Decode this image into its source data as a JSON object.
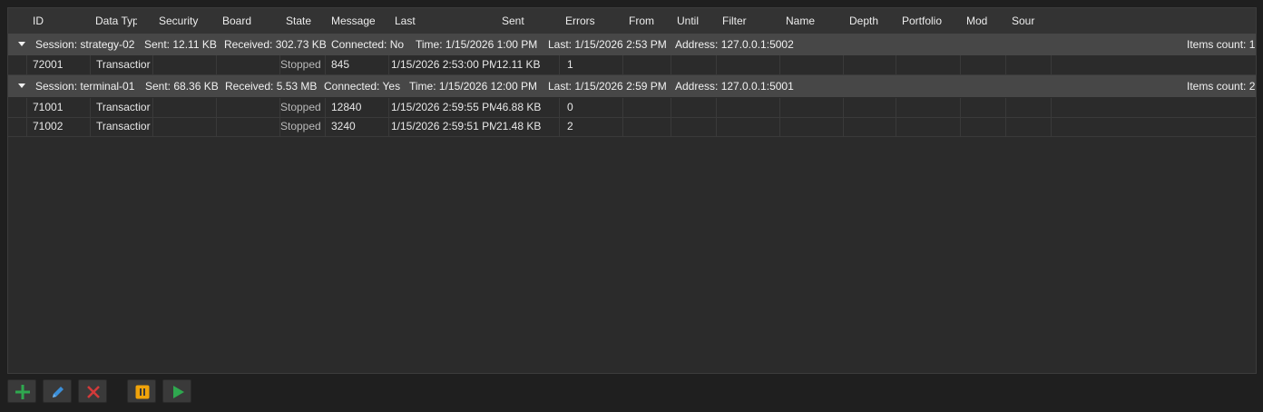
{
  "columns": [
    "ID",
    "Data Typ",
    "Security",
    "Board",
    "State",
    "Message",
    "Last",
    "Sent",
    "Errors",
    "From",
    "Until",
    "Filter",
    "Name",
    "Depth",
    "Portfolio",
    "Mod",
    "Sour"
  ],
  "groups": [
    {
      "session": "Session: strategy-02",
      "sent": "Sent: 12.11 KB",
      "received": "Received: 302.73 KB",
      "connected": "Connected: No",
      "time": "Time: 1/15/2026 1:00 PM",
      "last": "Last: 1/15/2026 2:53 PM",
      "address": "Address: 127.0.0.1:5002",
      "items_count": "Items count: 1",
      "rows": [
        {
          "id": "72001",
          "data_type": "Transactior",
          "state": "Stopped",
          "message": "845",
          "last": "1/15/2026 2:53:00 PM",
          "sent": "12.11 KB",
          "errors": "1"
        }
      ]
    },
    {
      "session": "Session: terminal-01",
      "sent": "Sent: 68.36 KB",
      "received": "Received: 5.53 MB",
      "connected": "Connected: Yes",
      "time": "Time: 1/15/2026 12:00 PM",
      "last": "Last: 1/15/2026 2:59 PM",
      "address": "Address: 127.0.0.1:5001",
      "items_count": "Items count: 2",
      "rows": [
        {
          "id": "71001",
          "data_type": "Transactior",
          "state": "Stopped",
          "message": "12840",
          "last": "1/15/2026 2:59:55 PM",
          "sent": "46.88 KB",
          "errors": "0"
        },
        {
          "id": "71002",
          "data_type": "Transactior",
          "state": "Stopped",
          "message": "3240",
          "last": "1/15/2026 2:59:51 PM",
          "sent": "21.48 KB",
          "errors": "2"
        }
      ]
    }
  ],
  "toolbar": {
    "buttons": [
      {
        "name": "add-button",
        "icon": "plus-icon",
        "color": "#2fa84f"
      },
      {
        "name": "edit-button",
        "icon": "pencil-icon",
        "color": "#3b8fd9"
      },
      {
        "name": "delete-button",
        "icon": "x-icon",
        "color": "#d23a3a"
      },
      {
        "name": "pause-button",
        "icon": "pause-icon",
        "color": "#f0a30a"
      },
      {
        "name": "start-button",
        "icon": "play-icon",
        "color": "#2fa84f"
      }
    ]
  }
}
